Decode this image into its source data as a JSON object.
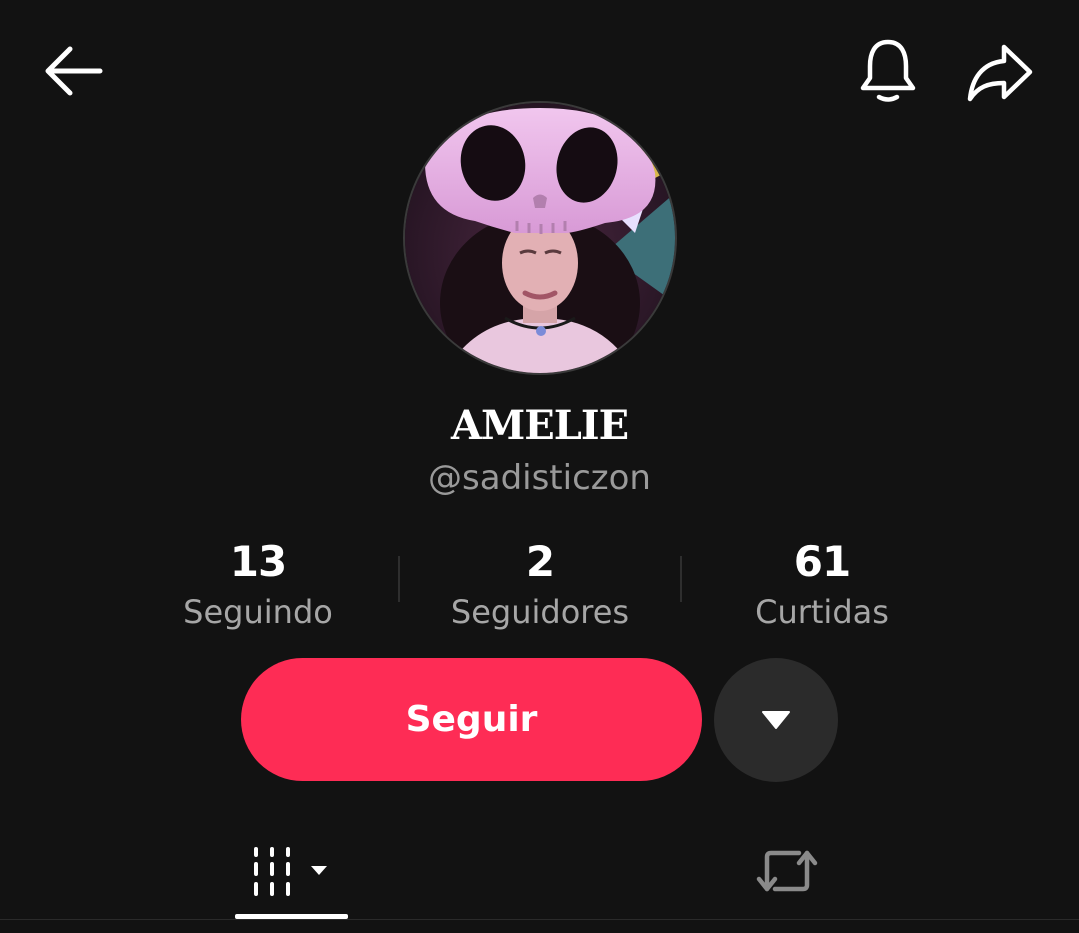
{
  "header": {
    "back_icon": "arrow-left-icon",
    "notification_icon": "bell-icon",
    "share_icon": "share-arrow-icon"
  },
  "profile": {
    "display_name": "AMELIE",
    "username": "@sadisticzon",
    "avatar_icon": "profile-photo"
  },
  "stats": [
    {
      "value": "13",
      "label": "Seguindo"
    },
    {
      "value": "2",
      "label": "Seguidores"
    },
    {
      "value": "61",
      "label": "Curtidas"
    }
  ],
  "actions": {
    "follow_label": "Seguir",
    "more_icon": "triangle-down-icon"
  },
  "tabs": [
    {
      "icon": "video-grid-icon",
      "active": true
    },
    {
      "icon": "repost-icon",
      "active": false
    }
  ],
  "colors": {
    "background": "#121212",
    "accent": "#fe2c55",
    "secondary_button": "#2b2b2b"
  }
}
